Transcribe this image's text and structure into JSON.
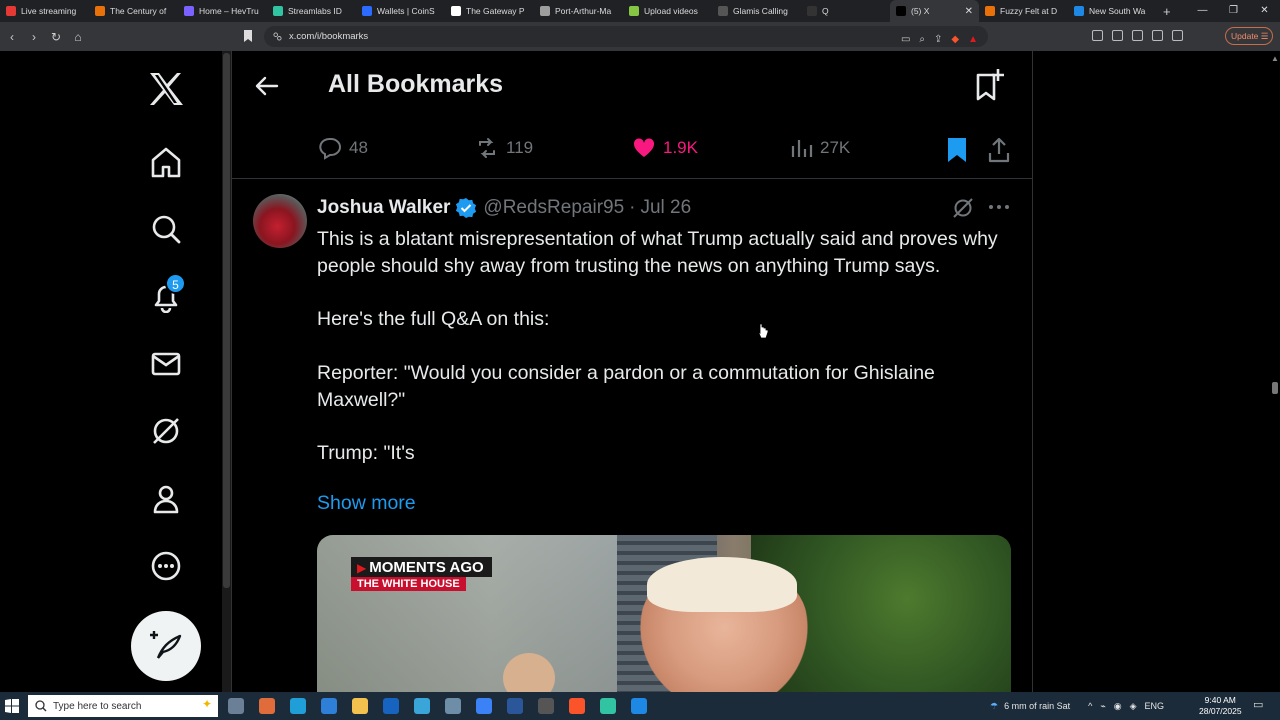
{
  "browser": {
    "tabs": [
      {
        "label": "Live streaming",
        "color": "#e53935"
      },
      {
        "label": "The Century of",
        "color": "#e8710a"
      },
      {
        "label": "Home – HevTru",
        "color": "#7b61ff"
      },
      {
        "label": "Streamlabs ID",
        "color": "#31c3a2"
      },
      {
        "label": "Wallets | CoinS",
        "color": "#2b6bff"
      },
      {
        "label": "The Gateway P",
        "color": "#ffffff"
      },
      {
        "label": "Port-Arthur-Ma",
        "color": "#9e9e9e"
      },
      {
        "label": "Upload videos",
        "color": "#85c742"
      },
      {
        "label": "Glamis Calling",
        "color": "#555555"
      },
      {
        "label": "Q",
        "color": "#333333"
      },
      {
        "label": "(5) X",
        "color": "#000000"
      },
      {
        "label": "Fuzzy Felt at D",
        "color": "#e8710a"
      },
      {
        "label": "New South Wa",
        "color": "#1e88e5"
      }
    ],
    "new_tab": "+",
    "url": "x.com/i/bookmarks",
    "update_label": "Update"
  },
  "nav": {
    "notification_count": "5"
  },
  "header": {
    "title": "All Bookmarks"
  },
  "actions": {
    "replies": "48",
    "reposts": "119",
    "likes": "1.9K",
    "views": "27K"
  },
  "tweet": {
    "author_name": "Joshua Walker",
    "handle": "@RedsRepair95",
    "separator": "·",
    "date": "Jul 26",
    "lines": [
      "This is a blatant misrepresentation of what Trump actually said and proves why people should shy away from trusting the news on anything Trump says.",
      "Here's the full Q&A on this:",
      "Reporter: \"Would you consider a pardon or a commutation for Ghislaine Maxwell?\"",
      "Trump: \"It's"
    ],
    "show_more": "Show more",
    "media": {
      "badge_top": "MOMENTS AGO",
      "badge_bottom": "THE WHITE HOUSE"
    }
  },
  "taskbar": {
    "search_placeholder": "Type here to search",
    "weather": "6 mm of rain Sat",
    "language": "ENG",
    "time": "9:40 AM",
    "date": "28/07/2025"
  },
  "colors": {
    "accent": "#1d9bf0",
    "like": "#f91880",
    "muted": "#71767b"
  }
}
